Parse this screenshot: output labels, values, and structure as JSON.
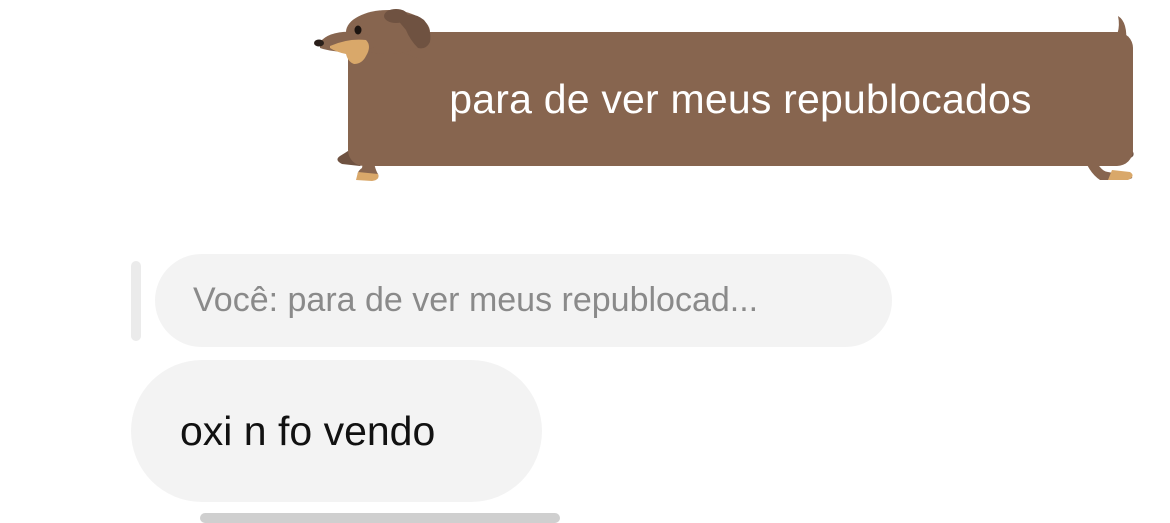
{
  "colors": {
    "dog_bubble": "#87654f",
    "dog_face": "#d9a86a",
    "incoming_bubble": "#f3f3f3",
    "reply_text": "#8a8a8a",
    "message_text": "#111111"
  },
  "outgoing_message": {
    "text": "para de ver meus republocados",
    "style_icon": "dachshund-bubble"
  },
  "reply_quote": {
    "text": "Você: para de ver meus republocad..."
  },
  "incoming_message": {
    "text": "oxi n fo vendo"
  }
}
